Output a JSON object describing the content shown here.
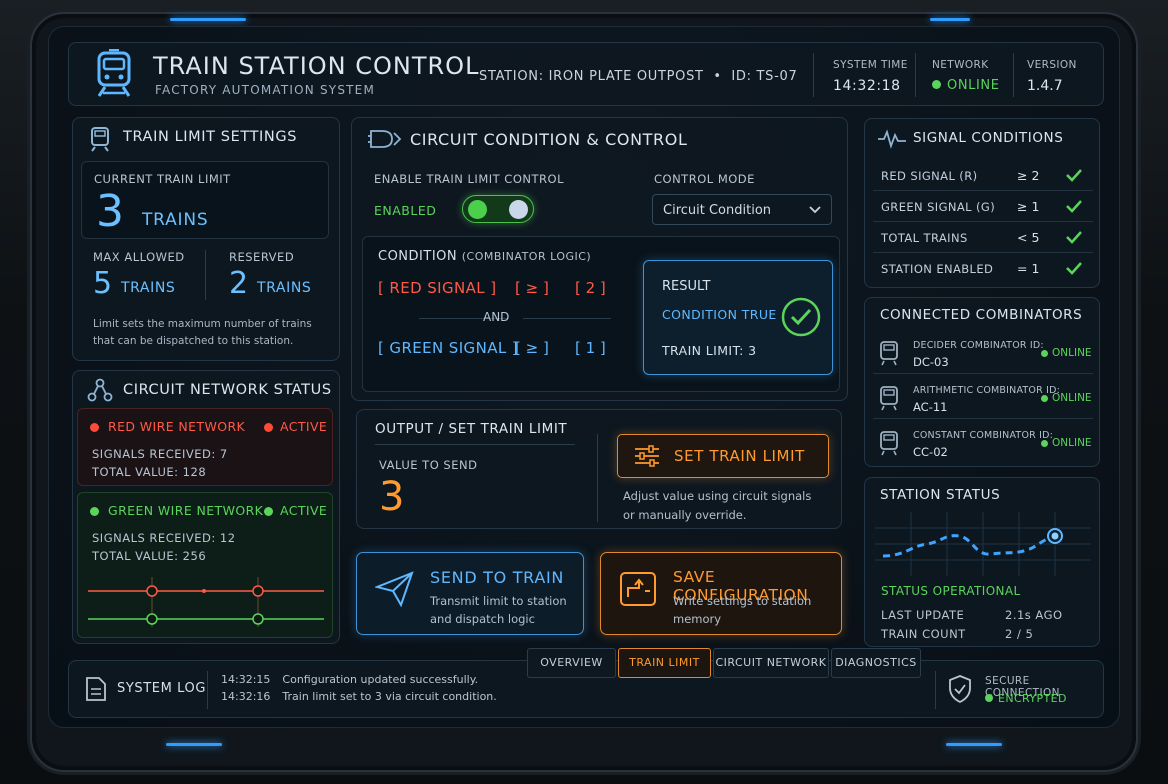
{
  "header": {
    "title": "TRAIN STATION CONTROL",
    "subtitle": "FACTORY AUTOMATION SYSTEM",
    "station": "STATION: IRON PLATE OUTPOST  •  ID: TS-07",
    "system_time_label": "SYSTEM TIME",
    "system_time": "14:32:18",
    "network_label": "NETWORK",
    "network_status": "ONLINE",
    "version_label": "VERSION",
    "version": "1.4.7"
  },
  "train_limit": {
    "title": "TRAIN LIMIT SETTINGS",
    "current_label": "CURRENT TRAIN LIMIT",
    "current_value": "3",
    "current_unit": "TRAINS",
    "max_label": "MAX ALLOWED",
    "max_value": "5",
    "max_unit": "TRAINS",
    "reserved_label": "RESERVED",
    "reserved_value": "2",
    "reserved_unit": "TRAINS",
    "note_line1": "Limit sets the maximum number of trains",
    "note_line2": "that can be dispatched to this station."
  },
  "circuit_network": {
    "title": "CIRCUIT NETWORK STATUS",
    "red": {
      "name": "RED WIRE NETWORK",
      "status": "ACTIVE",
      "signals": "SIGNALS RECEIVED: 7",
      "total": "TOTAL VALUE: 128"
    },
    "green": {
      "name": "GREEN WIRE NETWORK",
      "status": "ACTIVE",
      "signals": "SIGNALS RECEIVED: 12",
      "total": "TOTAL VALUE: 256"
    }
  },
  "control": {
    "title": "CIRCUIT CONDITION & CONTROL",
    "enable_label": "ENABLE TRAIN LIMIT CONTROL",
    "enable_state": "ENABLED",
    "mode_label": "CONTROL MODE",
    "mode_value": "Circuit Condition",
    "condition_title": "CONDITION",
    "condition_sub": "(COMBINATOR LOGIC)",
    "row1": {
      "signal": "[ RED SIGNAL ]",
      "op": "[ ≥ ]",
      "val": "[ 2 ]"
    },
    "and_label": "AND",
    "row2": {
      "signal": "[ GREEN SIGNAL ]",
      "op": "[ ≥ ]",
      "val": "[ 1 ]"
    },
    "result_label": "RESULT",
    "result_state": "CONDITION TRUE",
    "result_limit": "TRAIN LIMIT: 3"
  },
  "output": {
    "title": "OUTPUT / SET TRAIN LIMIT",
    "value_label": "VALUE TO SEND",
    "value": "3",
    "set_button": "SET TRAIN LIMIT",
    "hint_line1": "Adjust value using circuit signals",
    "hint_line2": "or manually override."
  },
  "actions": {
    "send_title": "SEND TO TRAIN",
    "send_desc1": "Transmit limit to station",
    "send_desc2": "and dispatch logic",
    "save_title": "SAVE CONFIGURATION",
    "save_desc1": "Write settings to station",
    "save_desc2": "memory"
  },
  "signal_conditions": {
    "title": "SIGNAL CONDITIONS",
    "rows": [
      {
        "name": "RED SIGNAL (R)",
        "cond": "≥ 2"
      },
      {
        "name": "GREEN SIGNAL (G)",
        "cond": "≥ 1"
      },
      {
        "name": "TOTAL TRAINS",
        "cond": "< 5"
      },
      {
        "name": "STATION ENABLED",
        "cond": "= 1"
      }
    ]
  },
  "combinators": {
    "title": "CONNECTED COMBINATORS",
    "items": [
      {
        "label": "DECIDER COMBINATOR ID:",
        "id": "DC-03",
        "status": "ONLINE"
      },
      {
        "label": "ARITHMETIC COMBINATOR ID:",
        "id": "AC-11",
        "status": "ONLINE"
      },
      {
        "label": "CONSTANT COMBINATOR ID:",
        "id": "CC-02",
        "status": "ONLINE"
      }
    ]
  },
  "station_status": {
    "title": "STATION STATUS",
    "state": "STATUS OPERATIONAL",
    "last_update_label": "LAST UPDATE",
    "last_update": "2.1s AGO",
    "train_count_label": "TRAIN COUNT",
    "train_count": "2 / 5"
  },
  "footer": {
    "log_title": "SYSTEM LOG",
    "log": [
      {
        "time": "14:32:15",
        "msg": "Configuration updated successfully."
      },
      {
        "time": "14:32:16",
        "msg": "Train limit set to 3 via circuit condition."
      }
    ],
    "tabs": [
      "OVERVIEW",
      "TRAIN LIMIT",
      "CIRCUIT NETWORK",
      "DIAGNOSTICS"
    ],
    "active_tab": "TRAIN LIMIT",
    "secure_label": "SECURE CONNECTION",
    "secure_state": "ENCRYPTED"
  },
  "colors": {
    "accent_blue": "#5fb8ff",
    "accent_orange": "#ff9a2e",
    "ok_green": "#5bd45b",
    "alert_red": "#ff5a47"
  }
}
